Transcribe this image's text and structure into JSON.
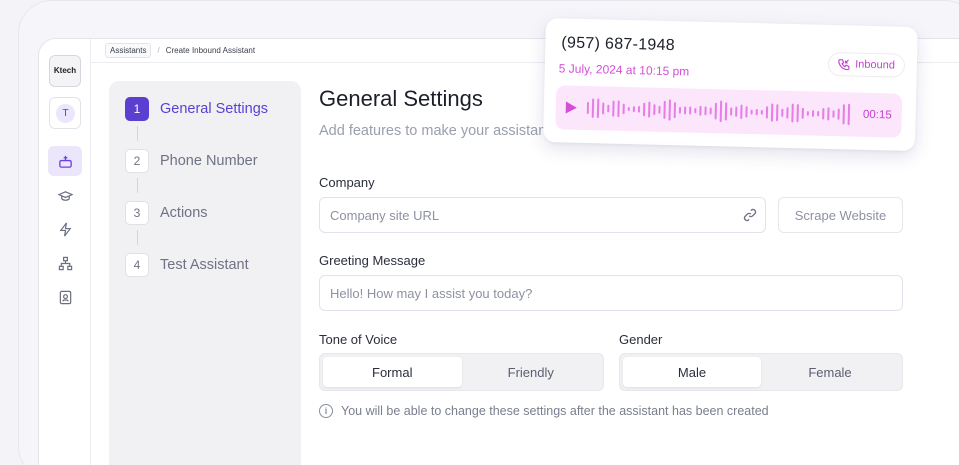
{
  "rail": {
    "logo_text": "Ktech",
    "avatar_initial": "T",
    "icons": [
      "assistant-icon",
      "graduation-cap-icon",
      "lightning-icon",
      "org-chart-icon",
      "contact-card-icon"
    ]
  },
  "breadcrumb": {
    "items": [
      "Assistants",
      "Create Inbound Assistant"
    ],
    "separator": "/"
  },
  "steps": [
    {
      "num": "1",
      "label": "General Settings",
      "active": true
    },
    {
      "num": "2",
      "label": "Phone Number",
      "active": false
    },
    {
      "num": "3",
      "label": "Actions",
      "active": false
    },
    {
      "num": "4",
      "label": "Test Assistant",
      "active": false
    }
  ],
  "main": {
    "title": "General Settings",
    "subtitle": "Add features to make your assistant a true",
    "company": {
      "label": "Company",
      "placeholder": "Company site URL",
      "scrape_label": "Scrape Website"
    },
    "greeting": {
      "label": "Greeting Message",
      "placeholder": "Hello! How may I assist you today?"
    },
    "tone": {
      "label": "Tone of Voice",
      "options": [
        "Formal",
        "Friendly"
      ],
      "selected": "Formal"
    },
    "gender": {
      "label": "Gender",
      "options": [
        "Male",
        "Female"
      ],
      "selected": "Male"
    },
    "note": "You will be able to change these settings after the assistant has been created"
  },
  "call_card": {
    "phone": "(957) 687-1948",
    "date": "5 July, 2024 at 10:15 pm",
    "badge": "Inbound",
    "duration": "00:15"
  },
  "colors": {
    "accent": "#5b3fd1",
    "pink": "#d34fd8",
    "pink_bg": "#fbe6fb"
  }
}
